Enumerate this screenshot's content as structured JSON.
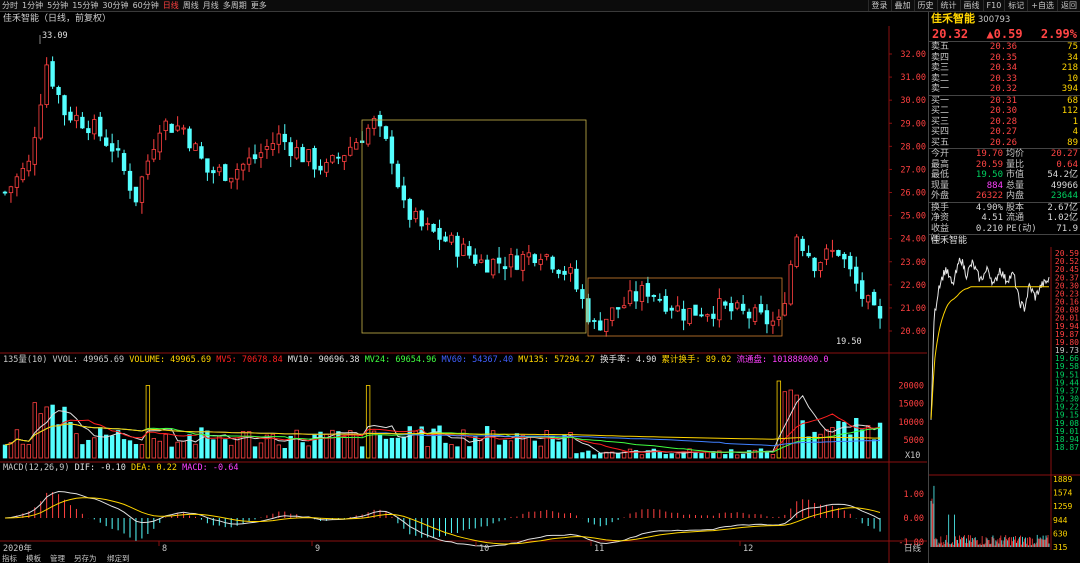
{
  "toolbar": {
    "timeframes": [
      "分时",
      "1分钟",
      "5分钟",
      "15分钟",
      "30分钟",
      "60分钟",
      "日线",
      "周线",
      "月线",
      "多周期",
      "更多"
    ],
    "active_timeframe": "日线",
    "tools": [
      "叠加",
      "历史",
      "统计",
      "画线",
      "F10",
      "标记",
      "+自选",
      "返回"
    ],
    "first_tool": "登录"
  },
  "title": "佳禾智能（日线，前复权）",
  "price_axis": [
    "32.00",
    "31.00",
    "30.00",
    "29.00",
    "28.00",
    "27.00",
    "26.00",
    "25.00",
    "24.00",
    "23.00",
    "22.00",
    "21.00",
    "20.00"
  ],
  "annotations": {
    "high": "33.09",
    "low": "19.50"
  },
  "volume_bar": {
    "period": "135量(10)",
    "vvol": "VVOL: 49965.69",
    "volume": "VOLUME: 49965.69",
    "mv5": "MV5: 70678.84",
    "mv10": "MV10: 90696.38",
    "mv24": "MV24: 69654.96",
    "mv60": "MV60: 54367.40",
    "mv135": "MV135: 57294.27",
    "turnover": "换手率: 4.90",
    "cum_turnover": "累计换手: 89.02",
    "float": "流通盘: 101888000.0"
  },
  "volume_axis": [
    "20000",
    "15000",
    "10000",
    "5000"
  ],
  "volume_unit": "X10",
  "macd_bar": {
    "label": "MACD(12,26,9)",
    "dif": "DIF: -0.10",
    "dea": "DEA: 0.22",
    "macd": "MACD: -0.64"
  },
  "macd_axis": [
    "1.00",
    "0.00",
    "-1.00"
  ],
  "date_axis": {
    "year": "2020年",
    "months": [
      "8",
      "9",
      "10",
      "11",
      "12"
    ],
    "unit": "日线"
  },
  "bottom_tabs": [
    "指标",
    "模板",
    "管理",
    "另存为",
    "绑定到"
  ],
  "right_panel": {
    "name": "佳禾智能",
    "code": "300793",
    "price": "20.32",
    "change": "▲0.59",
    "pct": "2.99%",
    "asks": [
      {
        "label": "卖五",
        "price": "20.36",
        "vol": "75"
      },
      {
        "label": "卖四",
        "price": "20.35",
        "vol": "34"
      },
      {
        "label": "卖三",
        "price": "20.34",
        "vol": "218"
      },
      {
        "label": "卖二",
        "price": "20.33",
        "vol": "10"
      },
      {
        "label": "卖一",
        "price": "20.32",
        "vol": "394"
      }
    ],
    "bids": [
      {
        "label": "买一",
        "price": "20.31",
        "vol": "68"
      },
      {
        "label": "买二",
        "price": "20.30",
        "vol": "112"
      },
      {
        "label": "买三",
        "price": "20.28",
        "vol": "1"
      },
      {
        "label": "买四",
        "price": "20.27",
        "vol": "4"
      },
      {
        "label": "买五",
        "price": "20.26",
        "vol": "89"
      }
    ],
    "stats1": [
      {
        "l1": "今开",
        "v1": "19.70",
        "c1": "red",
        "l2": "均价",
        "v2": "20.27",
        "c2": "red"
      },
      {
        "l1": "最高",
        "v1": "20.59",
        "c1": "red",
        "l2": "量比",
        "v2": "0.64",
        "c2": "red"
      },
      {
        "l1": "最低",
        "v1": "19.50",
        "c1": "grn",
        "l2": "市值",
        "v2": "54.2亿",
        "c2": "wht"
      },
      {
        "l1": "现量",
        "v1": "884",
        "c1": "mag",
        "l2": "总量",
        "v2": "49966",
        "c2": "wht"
      },
      {
        "l1": "外盘",
        "v1": "26322",
        "c1": "red",
        "l2": "内盘",
        "v2": "23644",
        "c2": "grn"
      }
    ],
    "stats2": [
      {
        "l1": "换手",
        "v1": "4.90%",
        "c1": "wht",
        "l2": "股本",
        "v2": "2.67亿",
        "c2": "wht"
      },
      {
        "l1": "净资",
        "v1": "4.51",
        "c1": "wht",
        "l2": "流通",
        "v2": "1.02亿",
        "c2": "wht"
      },
      {
        "l1": "收益㈢",
        "v1": "0.210",
        "c1": "wht",
        "l2": "PE(动)",
        "v2": "71.9",
        "c2": "wht"
      }
    ],
    "mini_title": "佳禾智能",
    "mini_axis": [
      "20.59",
      "20.52",
      "20.45",
      "20.37",
      "20.30",
      "20.23",
      "20.16",
      "20.08",
      "20.01",
      "19.94",
      "19.87",
      "19.80",
      "19.73",
      "19.66",
      "19.58",
      "19.51",
      "19.44",
      "19.37",
      "19.30",
      "19.22",
      "19.15",
      "19.08",
      "19.01",
      "18.94",
      "18.87"
    ],
    "mini_vol_axis": [
      "1889",
      "1574",
      "1259",
      "944",
      "630",
      "315"
    ]
  },
  "colors": {
    "up": "#ff4040",
    "down": "#54ffff",
    "mv5": "#e0e0e0",
    "mv10": "#ff2020",
    "mv24": "#40ff40",
    "mv60": "#4080ff",
    "mv135": "#ffd500",
    "box": "#c8b44a"
  }
}
